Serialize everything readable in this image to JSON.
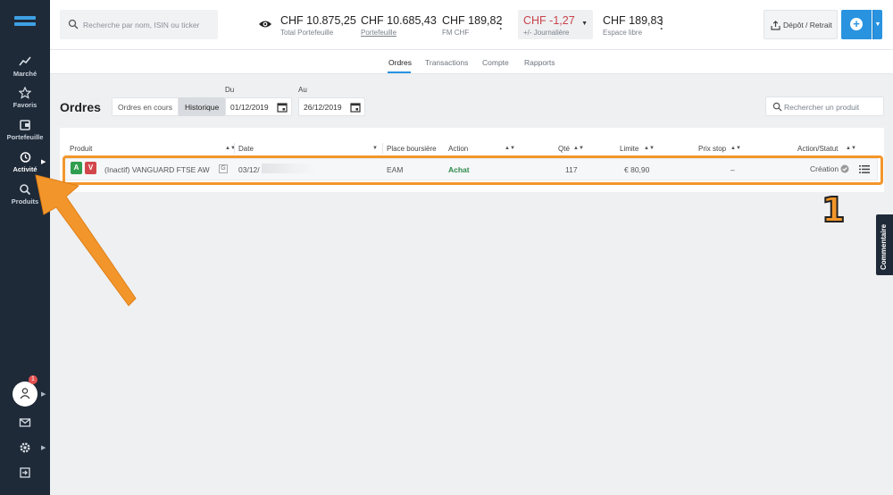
{
  "sidebar": {
    "items": [
      {
        "label": "Marché",
        "icon": "trend-icon"
      },
      {
        "label": "Favoris",
        "icon": "star-icon"
      },
      {
        "label": "Portefeuille",
        "icon": "wallet-icon"
      },
      {
        "label": "Activité",
        "icon": "history-icon"
      },
      {
        "label": "Produits",
        "icon": "search-icon"
      }
    ],
    "notification_count": "1"
  },
  "header": {
    "search_placeholder": "Recherche par nom, ISIN ou ticker",
    "stats": [
      {
        "value": "CHF 10.875,25",
        "label": "Total Portefeuille"
      },
      {
        "value": "CHF 10.685,43",
        "label": "Portefeuille"
      },
      {
        "value": "CHF 189,82",
        "label": "FM CHF"
      },
      {
        "value": "CHF -1,27",
        "label": "+/- Journalière"
      },
      {
        "value": "CHF 189,83",
        "label": "Espace libre"
      }
    ],
    "deposit_label": "Dépôt / Retrait",
    "plus_label": "+"
  },
  "tabs": [
    "Ordres",
    "Transactions",
    "Compte",
    "Rapports"
  ],
  "orders": {
    "title": "Ordres",
    "segments": [
      "Ordres en cours",
      "Historique"
    ],
    "from_label": "Du",
    "from_value": "01/12/2019",
    "to_label": "Au",
    "to_value": "26/12/2019",
    "product_search_placeholder": "Rechercher un produit",
    "columns": [
      "Produit",
      "Date",
      "Place boursière",
      "Action",
      "Qté",
      "Limite",
      "Prix stop",
      "Action/Statut"
    ],
    "row": {
      "buy": "A",
      "sell": "V",
      "product": "(Inactif) VANGUARD FTSE AW",
      "product_tag": "G",
      "date": "03/12/",
      "exchange": "EAM",
      "action": "Achat",
      "qty": "117",
      "limit": "€ 80,90",
      "stop": "–",
      "status": "Création"
    }
  },
  "annotation": {
    "number": "1"
  },
  "comment_tab": "Commentaire",
  "colors": {
    "accent": "#2993e0",
    "annotation": "#f2962b",
    "negative": "#c9434b",
    "buy": "#2f9e4e",
    "sell": "#d2474b",
    "sidebar": "#1f2a38"
  }
}
